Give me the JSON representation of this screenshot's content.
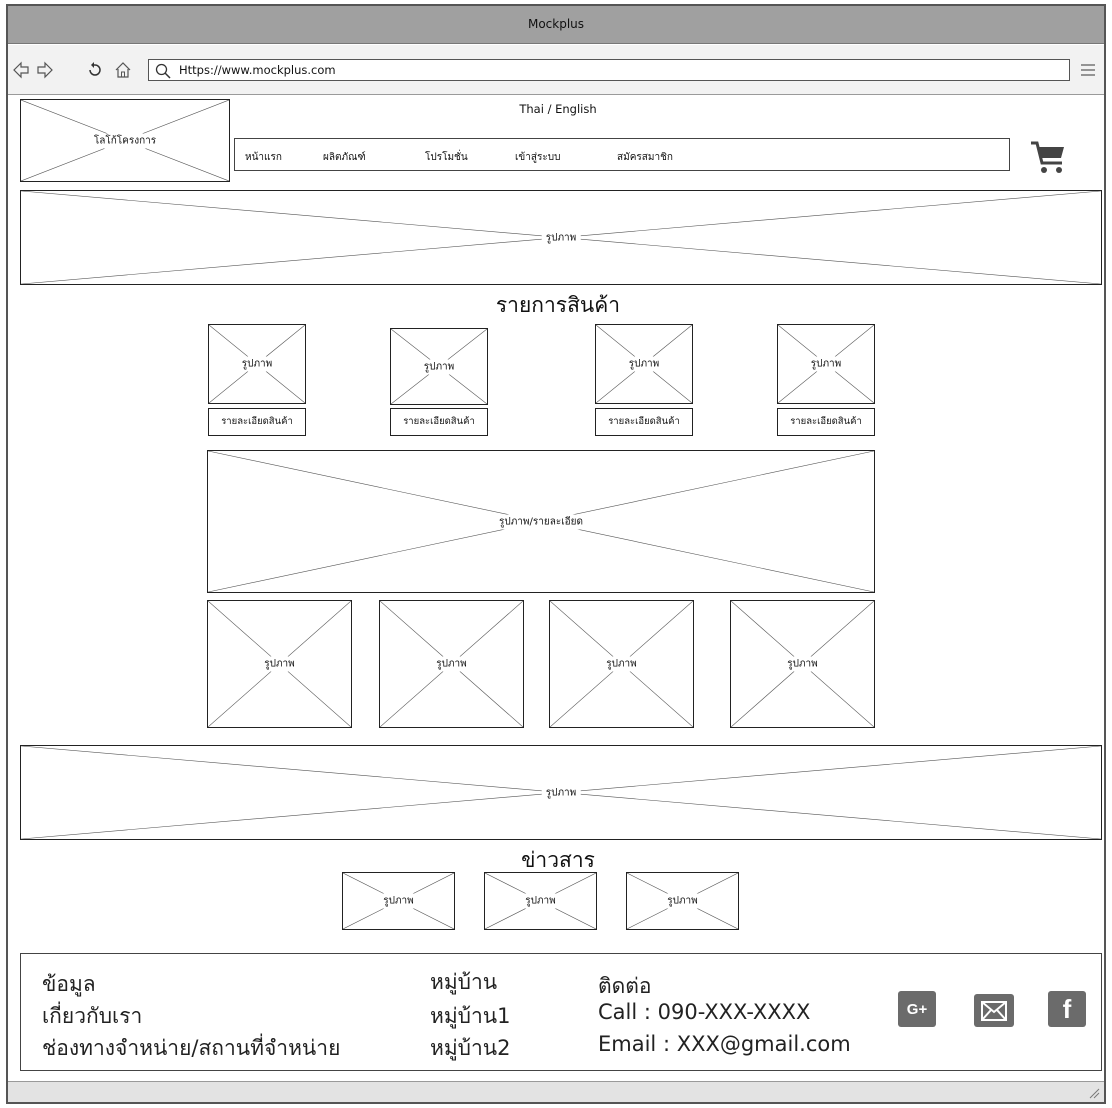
{
  "window": {
    "title": "Mockplus"
  },
  "browser": {
    "url": "Https://www.mockplus.com",
    "icons": [
      "back-icon",
      "forward-icon",
      "refresh-icon",
      "home-icon",
      "search-icon",
      "hamburger-menu-icon"
    ]
  },
  "header": {
    "logo_label": "โลโก้โครงการ",
    "language_switch": "Thai / English",
    "nav": [
      "หน้าแรก",
      "ผลิตภัณฑ์",
      "โปรโมชั่น",
      "เข้าสู่ระบบ",
      "สมัครสมาชิก"
    ],
    "cart_icon": "shopping-cart-icon"
  },
  "banner_top": {
    "label": "รูปภาพ"
  },
  "products": {
    "title": "รายการสินค้า",
    "items": [
      {
        "image_label": "รูปภาพ",
        "detail_label": "รายละเอียดสินค้า"
      },
      {
        "image_label": "รูปภาพ",
        "detail_label": "รายละเอียดสินค้า"
      },
      {
        "image_label": "รูปภาพ",
        "detail_label": "รายละเอียดสินค้า"
      },
      {
        "image_label": "รูปภาพ",
        "detail_label": "รายละเอียดสินค้า"
      }
    ],
    "feature_label": "รูปภาพ/รายละเอียด",
    "gallery": [
      "รูปภาพ",
      "รูปภาพ",
      "รูปภาพ",
      "รูปภาพ"
    ]
  },
  "banner_bottom": {
    "label": "รูปภาพ"
  },
  "news": {
    "title": "ข่าวสาร",
    "items": [
      "รูปภาพ",
      "รูปภาพ",
      "รูปภาพ"
    ]
  },
  "footer": {
    "col1": [
      "ข้อมูล",
      "เกี่ยวกับเรา",
      "ช่องทางจำหน่าย/สถานที่จำหน่าย"
    ],
    "col2": [
      "หมู่บ้าน",
      "หมู่บ้าน1",
      "หมู่บ้าน2"
    ],
    "contact_title": "ติดต่อ",
    "call": "Call : 090-XXX-XXXX",
    "email": "Email : XXX@gmail.com",
    "social_icons": [
      "google-plus-icon",
      "email-icon",
      "facebook-icon"
    ],
    "social_glyphs": {
      "google_plus": "G+",
      "facebook": "f"
    }
  },
  "colors": {
    "titlebar": "#a0a0a0",
    "social": "#6b6b6b",
    "border": "#222222"
  }
}
